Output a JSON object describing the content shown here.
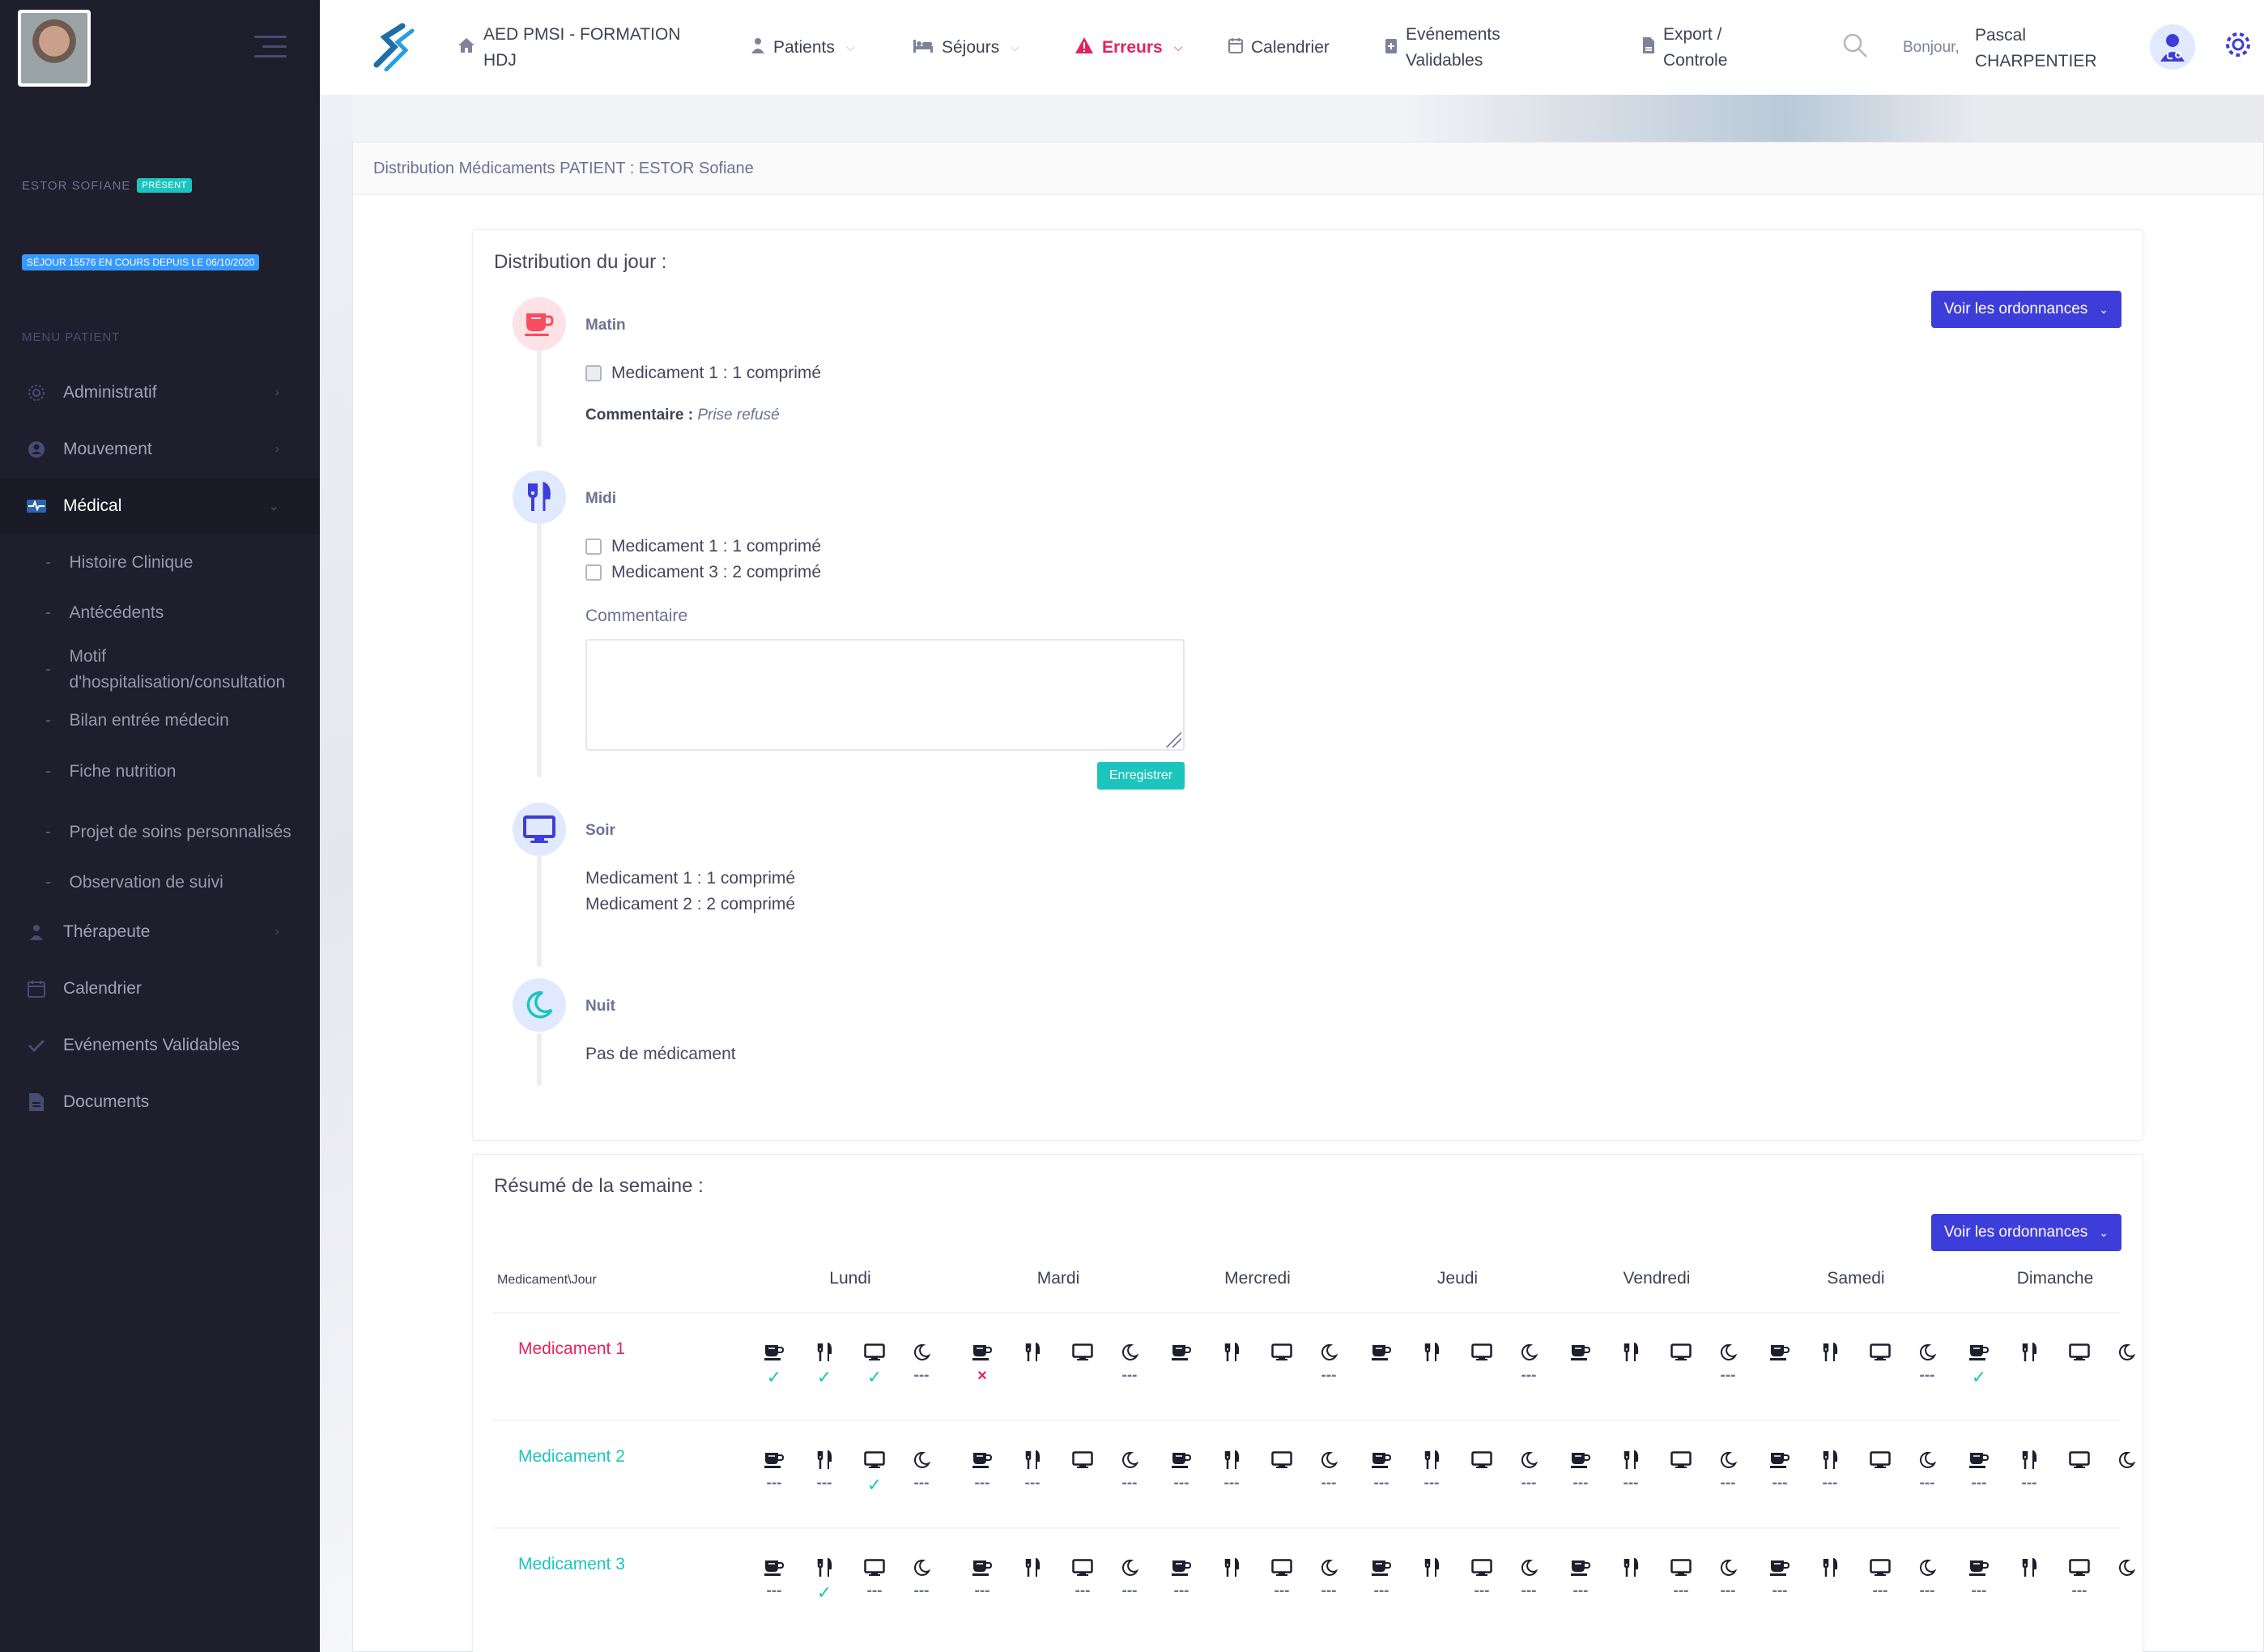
{
  "sidebar": {
    "patient_name": "ESTOR SOFIANE",
    "patient_status": "PRÉSENT",
    "sejour_badge": "SÉJOUR 15576 EN COURS DEPUIS LE 06/10/2020",
    "menu_title": "MENU PATIENT",
    "items": [
      {
        "label": "Administratif",
        "icon": "gear-icon",
        "chevron": "›"
      },
      {
        "label": "Mouvement",
        "icon": "user-circle-icon",
        "chevron": "›"
      },
      {
        "label": "Médical",
        "icon": "medical-icon",
        "chevron": "⌄"
      },
      {
        "label": "Thérapeute",
        "icon": "therapist-icon",
        "chevron": "›"
      },
      {
        "label": "Calendrier",
        "icon": "calendar-icon",
        "chevron": ""
      },
      {
        "label": "Evénements Validables",
        "icon": "check-icon",
        "chevron": ""
      },
      {
        "label": "Documents",
        "icon": "document-icon",
        "chevron": ""
      }
    ],
    "medical_sub": [
      "Histoire Clinique",
      "Antécédents",
      "Motif d'hospitalisation/consultation",
      "Bilan entrée médecin",
      "Fiche nutrition",
      "Projet de soins personnalisés",
      "Observation de suivi"
    ],
    "dash": "-"
  },
  "header": {
    "home_line1": "AED PMSI - FORMATION",
    "home_line2": "HDJ",
    "nav": {
      "patients": "Patients",
      "sejours": "Séjours",
      "erreurs": "Erreurs",
      "calendrier": "Calendrier",
      "evenements_1": "Evénements",
      "evenements_2": "Validables",
      "export_1": "Export /",
      "export_2": "Controle"
    },
    "greeting": "Bonjour,",
    "user_first": "Pascal",
    "user_last": "CHARPENTIER"
  },
  "main": {
    "card_title": "Distribution Médicaments PATIENT : ESTOR Sofiane",
    "day": {
      "title": "Distribution du jour :",
      "button": "Voir les ordonnances",
      "matin": {
        "label": "Matin",
        "meds": [
          "Medicament 1 : 1 comprimé"
        ],
        "comment_label": "Commentaire :",
        "comment_value": "Prise refusé"
      },
      "midi": {
        "label": "Midi",
        "meds": [
          "Medicament 1 : 1 comprimé",
          "Medicament 3 : 2 comprimé"
        ],
        "comment_label": "Commentaire",
        "save": "Enregistrer"
      },
      "soir": {
        "label": "Soir",
        "meds": [
          "Medicament 1 : 1 comprimé",
          "Medicament 2 : 2 comprimé"
        ]
      },
      "nuit": {
        "label": "Nuit",
        "meds": [
          "Pas de médicament"
        ]
      }
    },
    "week": {
      "title": "Résumé de la semaine :",
      "button": "Voir les ordonnances",
      "corner": "Medicament\\Jour",
      "days": [
        "Lundi",
        "Mardi",
        "Mercredi",
        "Jeudi",
        "Vendredi",
        "Samedi",
        "Dimanche"
      ],
      "meds": [
        {
          "name": "Medicament 1",
          "color": "#e0245e",
          "status": [
            [
              "ok",
              "ok",
              "ok",
              "---"
            ],
            [
              "no",
              "",
              "",
              "---"
            ],
            [
              "",
              "",
              "",
              "---"
            ],
            [
              "",
              "",
              "",
              "---"
            ],
            [
              "",
              "",
              "",
              "---"
            ],
            [
              "",
              "",
              "",
              "---"
            ],
            [
              "ok",
              "",
              "",
              ""
            ]
          ]
        },
        {
          "name": "Medicament 2",
          "color": "#1bc5bd",
          "status": [
            [
              "---",
              "---",
              "ok",
              "---"
            ],
            [
              "---",
              "---",
              "",
              "---"
            ],
            [
              "---",
              "---",
              "",
              "---"
            ],
            [
              "---",
              "---",
              "",
              "---"
            ],
            [
              "---",
              "---",
              "",
              "---"
            ],
            [
              "---",
              "---",
              "",
              "---"
            ],
            [
              "---",
              "---",
              "",
              ""
            ]
          ]
        },
        {
          "name": "Medicament 3",
          "color": "#1bc5bd",
          "status": [
            [
              "---",
              "ok",
              "---",
              "---"
            ],
            [
              "---",
              "",
              "---",
              "---"
            ],
            [
              "---",
              "",
              "---",
              "---"
            ],
            [
              "---",
              "",
              "---",
              "---"
            ],
            [
              "---",
              "",
              "---",
              "---"
            ],
            [
              "---",
              "",
              "---",
              "---"
            ],
            [
              "---",
              "",
              "---",
              ""
            ]
          ]
        }
      ]
    }
  },
  "colors": {
    "sidebar_bg": "#1e1e2d",
    "accent": "#3d3dd9",
    "success": "#1bc5bd",
    "danger": "#e0245e"
  },
  "glyphs": {
    "check": "✓",
    "cross": "×"
  }
}
